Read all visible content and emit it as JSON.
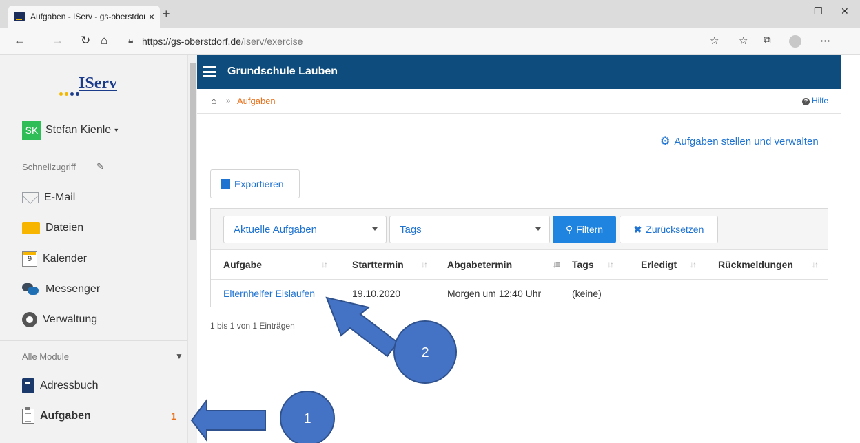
{
  "browser": {
    "tab_title": "Aufgaben - IServ - gs-oberstdorf",
    "tab_close": "×",
    "new_tab": "+",
    "url_host": "https://gs-oberstdorf.de",
    "url_path": "/iserv/exercise",
    "window_controls": {
      "minimize": "–",
      "restore": "❐",
      "close": "✕"
    },
    "nav": {
      "back": "←",
      "forward": "→",
      "refresh": "↻",
      "home": "⌂"
    },
    "toolbar_icons": [
      "star-icon",
      "favorites-icon",
      "collections-icon",
      "profile-icon",
      "more-icon"
    ],
    "toolbar_glyphs": {
      "star": "☆",
      "favorites": "☆",
      "collections": "⧉",
      "more": "⋯"
    }
  },
  "sidebar": {
    "logo_text": "IServ",
    "logo_dot_colors": [
      "#f2b800",
      "#f2b800",
      "#1b3b8b",
      "#1b3b8b"
    ],
    "user": {
      "initials": "SK",
      "name": "Stefan Kienle",
      "caret": "▾"
    },
    "quick_access_label": "Schnellzugriff",
    "quick_items": [
      {
        "label": "E-Mail",
        "icon": "mail-icon"
      },
      {
        "label": "Dateien",
        "icon": "folder-icon"
      },
      {
        "label": "Kalender",
        "icon": "calendar-icon",
        "day": "9"
      },
      {
        "label": "Messenger",
        "icon": "messenger-icon"
      },
      {
        "label": "Verwaltung",
        "icon": "gear-icon"
      }
    ],
    "all_modules_label": "Alle Module",
    "modules": [
      {
        "label": "Adressbuch",
        "icon": "addressbook-icon"
      },
      {
        "label": "Aufgaben",
        "icon": "tasks-icon",
        "badge": "1"
      }
    ]
  },
  "header": {
    "school_name": "Grundschule Lauben"
  },
  "breadcrumb": {
    "separator": "»",
    "current": "Aufgaben",
    "help": "Hilfe"
  },
  "actions": {
    "manage_link": "Aufgaben stellen und verwalten",
    "export_label": "Exportieren"
  },
  "filters": {
    "status_select": "Aktuelle Aufgaben",
    "tags_select": "Tags",
    "filter_button": "Filtern",
    "reset_button": "Zurücksetzen"
  },
  "table": {
    "columns": [
      "Aufgabe",
      "Starttermin",
      "Abgabetermin",
      "Tags",
      "Erledigt",
      "Rückmeldungen"
    ],
    "rows": [
      {
        "aufgabe": "Elternhelfer Eislaufen",
        "starttermin": "19.10.2020",
        "abgabetermin": "Morgen um 12:40 Uhr",
        "tags": "(keine)",
        "erledigt": "",
        "rueckmeldungen": ""
      }
    ],
    "info": "1 bis 1 von 1 Einträgen"
  },
  "annotations": [
    {
      "label": "1"
    },
    {
      "label": "2"
    }
  ],
  "colors": {
    "navbar": "#0d4c7c",
    "accent_orange": "#e8711c",
    "link_blue": "#1f73d1",
    "filter_blue": "#1f84e0",
    "annotation_fill": "#4472c4",
    "annotation_stroke": "#2f528f"
  }
}
